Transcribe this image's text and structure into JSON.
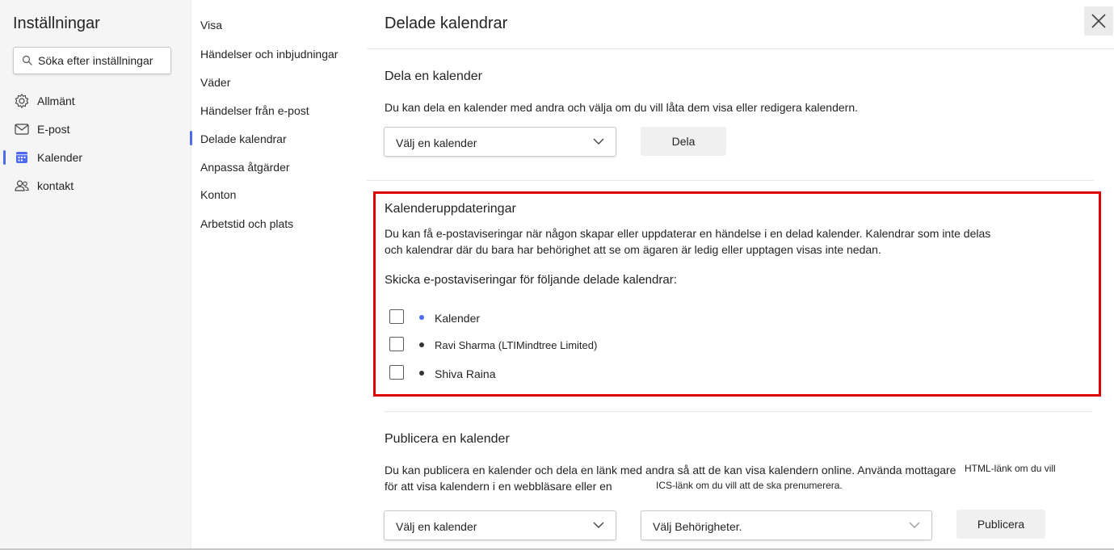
{
  "left": {
    "title": "Inställningar",
    "search": {
      "placeholder": "Söka efter inställningar",
      "value": ""
    },
    "categories": [
      {
        "label": "Allmänt",
        "icon": "gear-icon"
      },
      {
        "label": "E-post",
        "icon": "mail-icon"
      },
      {
        "label": "Kalender",
        "icon": "calendar-icon",
        "active": true
      },
      {
        "label": "kontakt",
        "icon": "people-icon"
      }
    ]
  },
  "middle": {
    "items": [
      {
        "label": "Visa"
      },
      {
        "label": "Händelser och inbjudningar"
      },
      {
        "label": "Väder"
      },
      {
        "label": "Händelser från e-post"
      },
      {
        "label": "Delade kalendrar",
        "active": true
      },
      {
        "label": "Anpassa åtgärder"
      },
      {
        "label": "Konton"
      },
      {
        "label": "Arbetstid och plats"
      }
    ]
  },
  "main": {
    "title": "Delade kalendrar",
    "share": {
      "title": "Dela en kalender",
      "description": "Du kan dela en kalender med andra och välja om du vill låta dem visa eller redigera kalendern.",
      "select_value": "Välj en kalender",
      "button": "Dela"
    },
    "updates": {
      "title": "Kalenderuppdateringar",
      "description_line1": "Du kan få e-postaviseringar när någon skapar eller uppdaterar en händelse i en delad kalender. Kalendrar som inte delas",
      "description_line2": "och kalendrar där du bara har behörighet att se om ägaren är ledig eller upptagen visas inte nedan.",
      "prompt": "Skicka e-postaviseringar för följande delade kalendrar:",
      "calendars": [
        {
          "name": "Kalender",
          "dot_color": "#4f6bed",
          "checked": false
        },
        {
          "name": "Ravi Sharma (LTIMindtree Limited)",
          "dot_color": "#333333",
          "checked": false
        },
        {
          "name": "Shiva Raina",
          "dot_color": "#333333",
          "checked": false
        }
      ]
    },
    "publish": {
      "title": "Publicera en kalender",
      "description_line1": "Du kan publicera en kalender och dela en länk med andra så att de kan visa kalendern online. Använda mottagare",
      "html_note": "HTML-länk om du vill",
      "description_line2": "för att visa kalendern i en webbläsare eller en",
      "ics_note": "ICS-länk om du vill att de ska prenumerera.",
      "calendar_select": "Välj en kalender",
      "permission_select": "Välj Behörigheter.",
      "button": "Publicera"
    }
  },
  "colors": {
    "accent": "#4f6bed",
    "highlight_border": "#e00000"
  }
}
